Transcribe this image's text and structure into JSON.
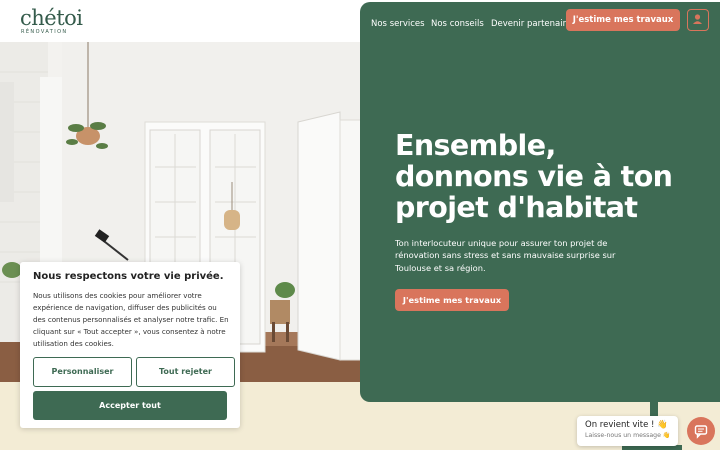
{
  "brand": {
    "name": "chétoi",
    "tagline": "RÉNOVATION"
  },
  "nav": {
    "links": [
      "Nos services",
      "Nos conseils",
      "Devenir partenaire"
    ],
    "cta": "J'estime mes travaux",
    "account_icon": "user-icon"
  },
  "hero": {
    "title_lines": [
      "Ensemble,",
      "donnons vie à ton",
      "projet d'habitat"
    ],
    "description": "Ton interlocuteur unique pour assurer ton projet de rénovation sans stress et sans mauvaise surprise sur Toulouse et sa région.",
    "cta": "J'estime mes travaux"
  },
  "cookie": {
    "title": "Nous respectons votre vie privée.",
    "text": "Nous utilisons des cookies pour améliorer votre expérience de navigation, diffuser des publicités ou des contenus personnalisés et analyser notre trafic. En cliquant sur « Tout accepter », vous consentez à notre utilisation des cookies.",
    "customize": "Personnaliser",
    "reject": "Tout rejeter",
    "accept": "Accepter tout"
  },
  "chat": {
    "title": "On revient vite ! 👋",
    "subtitle": "Laisse-nous un message 👋",
    "icon": "chat-icon"
  },
  "colors": {
    "green": "#3e6a53",
    "orange": "#d9755c",
    "beige": "#f3ecd5",
    "white": "#ffffff"
  }
}
